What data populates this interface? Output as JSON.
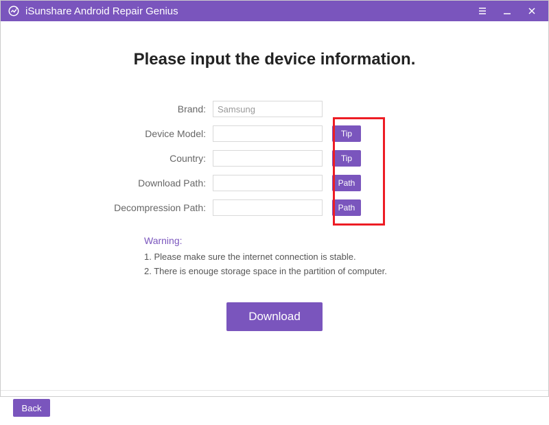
{
  "titlebar": {
    "title": "iSunshare Android Repair Genius"
  },
  "heading": "Please input the device information.",
  "form": {
    "rows": [
      {
        "label": "Brand:",
        "value": "Samsung",
        "disabled": true,
        "side_btn": null
      },
      {
        "label": "Device Model:",
        "value": "",
        "disabled": false,
        "side_btn": "Tip"
      },
      {
        "label": "Country:",
        "value": "",
        "disabled": false,
        "side_btn": "Tip"
      },
      {
        "label": "Download Path:",
        "value": "",
        "disabled": false,
        "side_btn": "Path"
      },
      {
        "label": "Decompression Path:",
        "value": "",
        "disabled": false,
        "side_btn": "Path"
      }
    ]
  },
  "warning": {
    "title": "Warning:",
    "lines": [
      "1. Please make sure the internet connection is stable.",
      "2. There is enouge storage space in the partition of computer."
    ]
  },
  "buttons": {
    "download": "Download",
    "back": "Back"
  }
}
